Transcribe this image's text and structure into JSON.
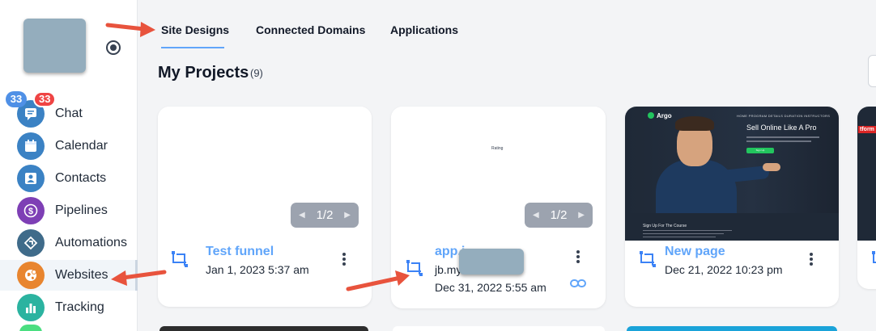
{
  "sidebar": {
    "badges": {
      "left": "33",
      "right": "33"
    },
    "items": [
      {
        "label": "Chat",
        "icon": "chat-icon",
        "color": "#3b82c4"
      },
      {
        "label": "Calendar",
        "icon": "calendar-icon",
        "color": "#3b82c4"
      },
      {
        "label": "Contacts",
        "icon": "contacts-icon",
        "color": "#3b82c4"
      },
      {
        "label": "Pipelines",
        "icon": "dollar-icon",
        "color": "#7e3fb5"
      },
      {
        "label": "Automations",
        "icon": "automation-icon",
        "color": "#3f6b8a"
      },
      {
        "label": "Websites",
        "icon": "globe-icon",
        "color": "#e8852f"
      },
      {
        "label": "Tracking",
        "icon": "chart-icon",
        "color": "#2bb3a0"
      }
    ]
  },
  "tabs": [
    "Site Designs",
    "Connected Domains",
    "Applications"
  ],
  "projects": {
    "title": "My Projects",
    "count": "(9)"
  },
  "cards": [
    {
      "title": "Test funnel",
      "subtitle": "Jan 1, 2023 5:37 am",
      "pager": "1/2"
    },
    {
      "title": "app.j...",
      "subtitle": "jb.my",
      "date": "Dec 31, 2022 5:55 am",
      "pager": "1/2",
      "thumb_text": "Rating"
    },
    {
      "title": "New page",
      "subtitle": "Dec 21, 2022 10:23 pm",
      "thumb": {
        "logo": "Argo",
        "nav": "HOME  PROGRAM  DETAILS  DURATION  INSTRUCTORS",
        "headline": "Sell Online Like A Pro",
        "cta": "Sign Up",
        "section": "Sign Up For The Course"
      }
    },
    {
      "thumb_label": "tform"
    }
  ],
  "colors": {
    "accent": "#60a5fa",
    "arrow": "#e8533d",
    "pager": "#9ca3af"
  }
}
